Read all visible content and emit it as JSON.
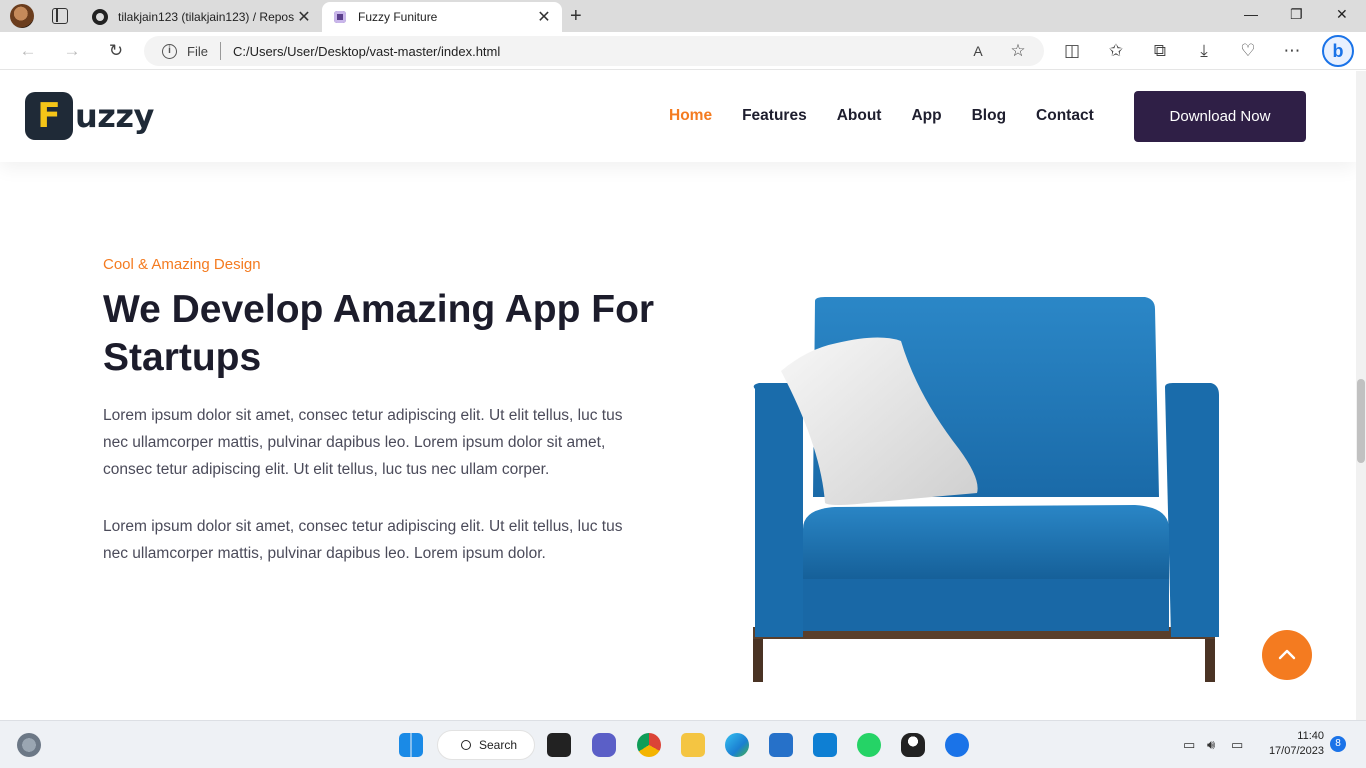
{
  "browser": {
    "tabs": [
      {
        "label": "tilakjain123 (tilakjain123) / Repos",
        "active": false
      },
      {
        "label": "Fuzzy Funiture",
        "active": true
      }
    ],
    "address": {
      "scheme_label": "File",
      "url": "C:/Users/User/Desktop/vast-master/index.html"
    }
  },
  "site": {
    "logo": {
      "letter": "F",
      "rest": "uzzy"
    },
    "nav": [
      "Home",
      "Features",
      "About",
      "App",
      "Blog",
      "Contact"
    ],
    "active_nav": "Home",
    "cta_label": "Download Now"
  },
  "hero": {
    "eyebrow": "Cool & Amazing Design",
    "headline": "We Develop Amazing App For Startups",
    "paragraph_1": "Lorem ipsum dolor sit amet, consec tetur adipiscing elit. Ut elit tellus, luc tus nec ullamcorper mattis, pulvinar dapibus leo. Lorem ipsum dolor sit amet, consec tetur adipiscing elit. Ut elit tellus, luc tus nec ullam corper.",
    "paragraph_2": "Lorem ipsum dolor sit amet, consec tetur adipiscing elit. Ut elit tellus, luc tus nec ullamcorper mattis, pulvinar dapibus leo. Lorem ipsum dolor."
  },
  "taskbar": {
    "search_label": "Search",
    "time": "11:40",
    "date": "17/07/2023",
    "notification_count": "8"
  },
  "colors": {
    "accent": "#f47b20",
    "cta": "#2f1f46",
    "chair": "#1d77b8"
  }
}
